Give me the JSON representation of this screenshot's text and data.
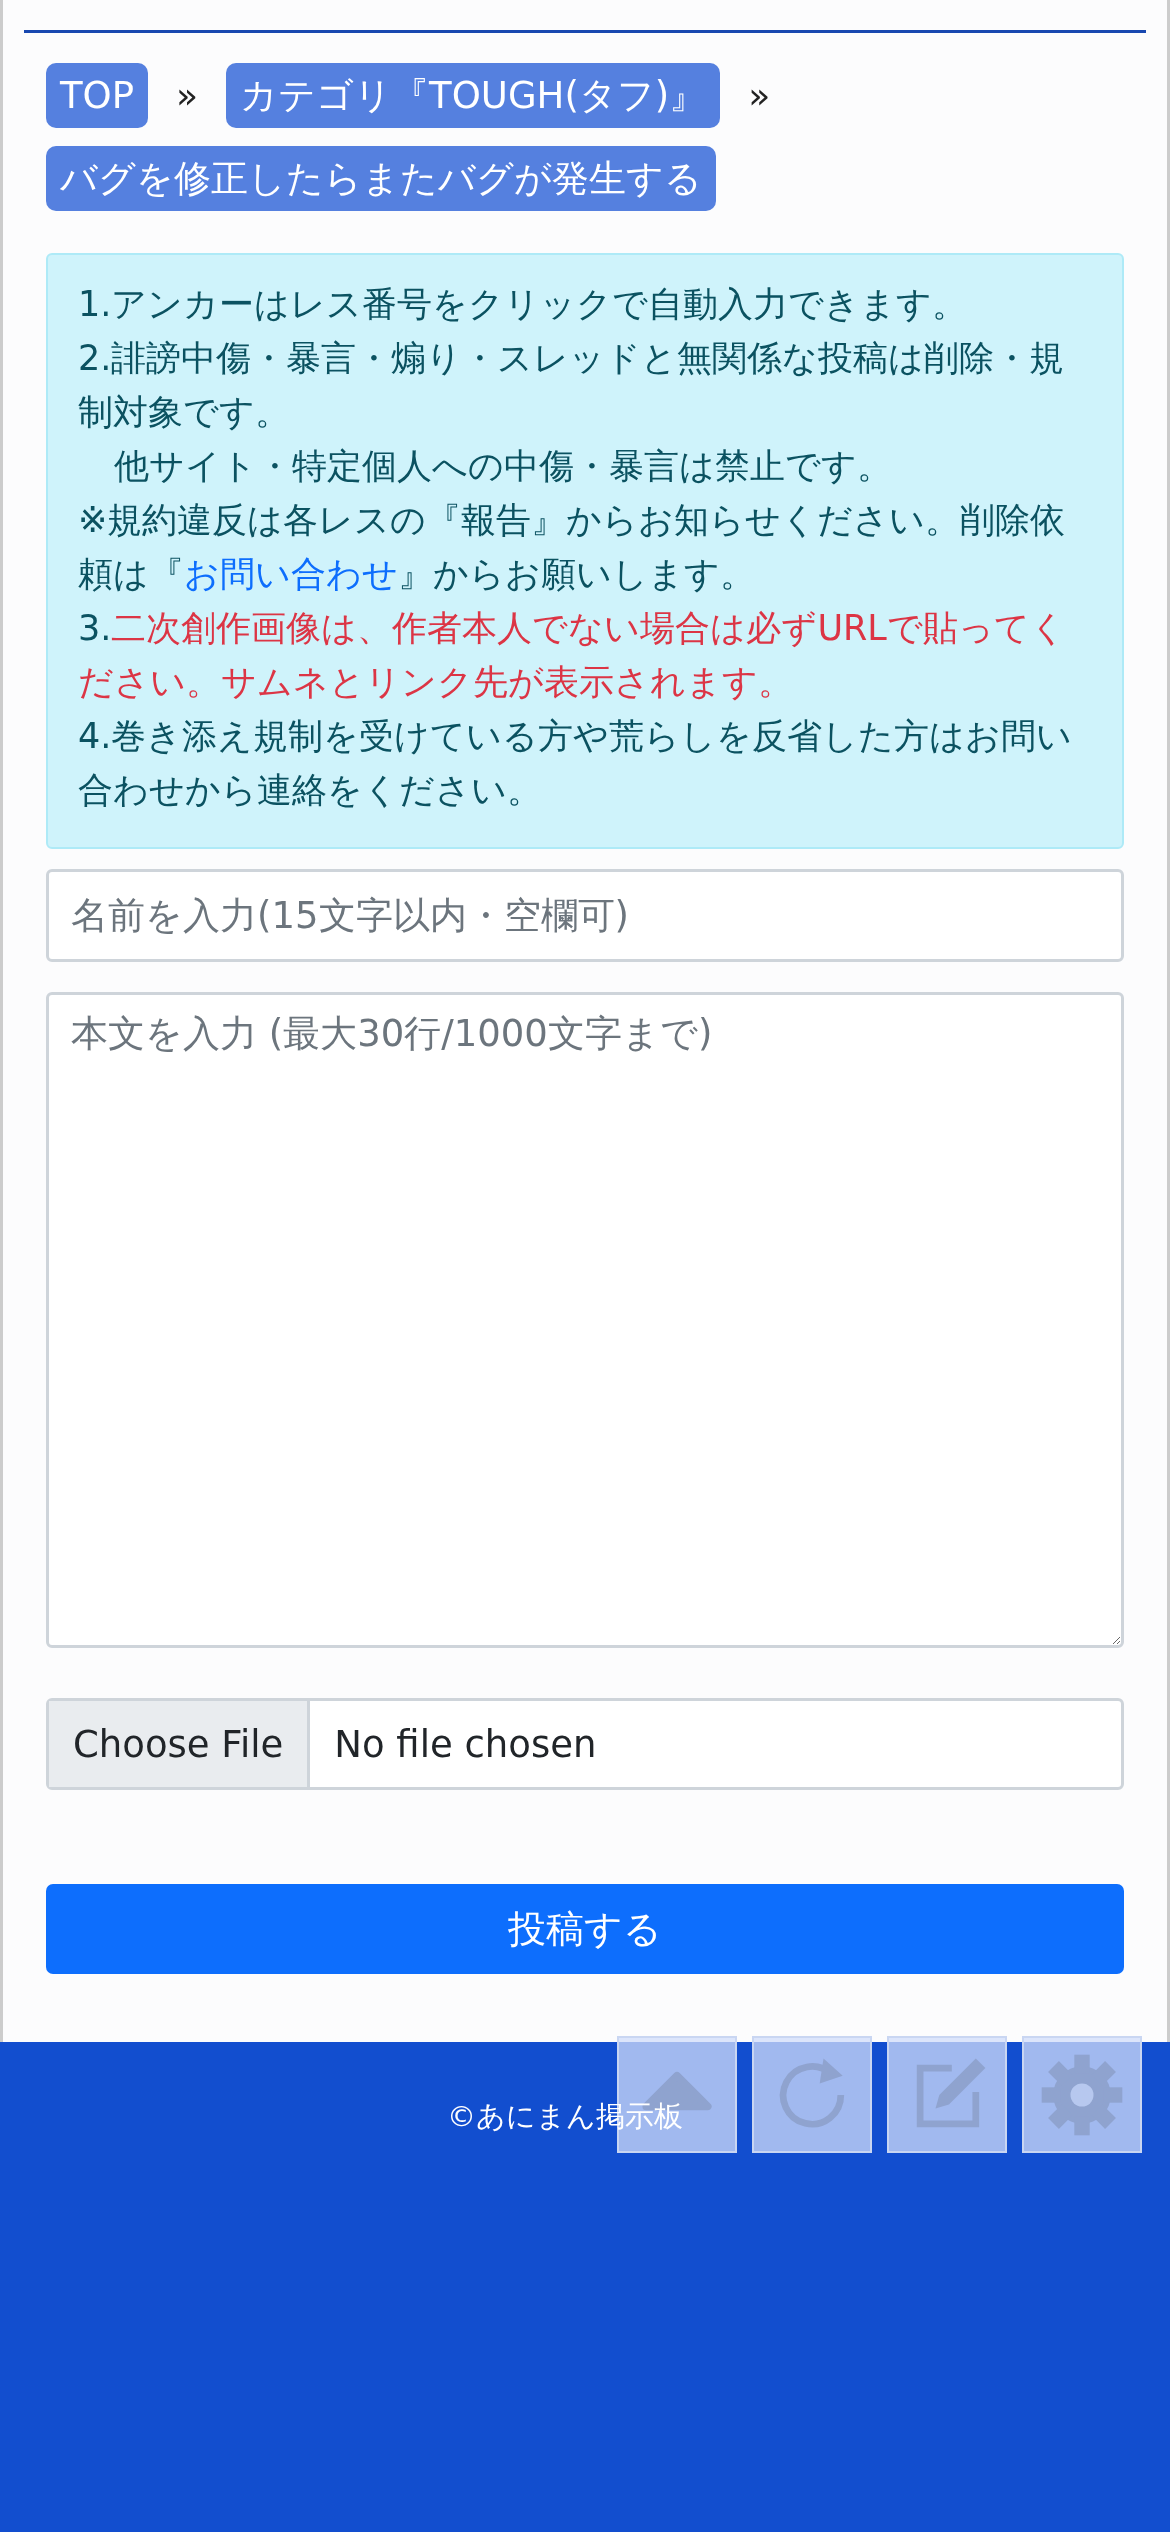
{
  "breadcrumbs": [
    {
      "label": "TOP",
      "separator": "»"
    },
    {
      "label": "カテゴリ『TOUGH(タフ)』",
      "separator": "»"
    },
    {
      "label": "バグを修正したらまたバグが発生する"
    }
  ],
  "notice": [
    {
      "kind": "plain",
      "text": "1.アンカーはレス番号をクリックで自動入力できます。"
    },
    {
      "kind": "plain",
      "text": "2.誹謗中傷・暴言・煽り・スレッドと無関係な投稿は削除・規制対象です。"
    },
    {
      "kind": "indent",
      "text": "他サイト・特定個人への中傷・暴言は禁止です。"
    },
    {
      "kind": "link",
      "before": "※規約違反は各レスの『報告』からお知らせください。削除依頼は『",
      "link": "お問い合わせ",
      "after": "』からお願いします。"
    },
    {
      "kind": "alert",
      "prefix": "3.",
      "text": "二次創作画像は、作者本人でない場合は必ずURLで貼ってください。サムネとリンク先が表示されます。"
    },
    {
      "kind": "plain",
      "text": "4.巻き添え規制を受けている方や荒らしを反省した方はお問い合わせから連絡をください。"
    }
  ],
  "name_field": {
    "placeholder": "名前を入力(15文字以内・空欄可)"
  },
  "body_field": {
    "placeholder": "本文を入力 (最大30行/1000文字まで)"
  },
  "file_input": {
    "button": "Choose File",
    "status": "No file chosen"
  },
  "submit": "投稿する",
  "footer": {
    "copyright": "©あにまん掲示板"
  },
  "float_buttons": [
    {
      "kind": "up"
    },
    {
      "kind": "reload"
    },
    {
      "kind": "edit"
    },
    {
      "kind": "settings"
    }
  ]
}
